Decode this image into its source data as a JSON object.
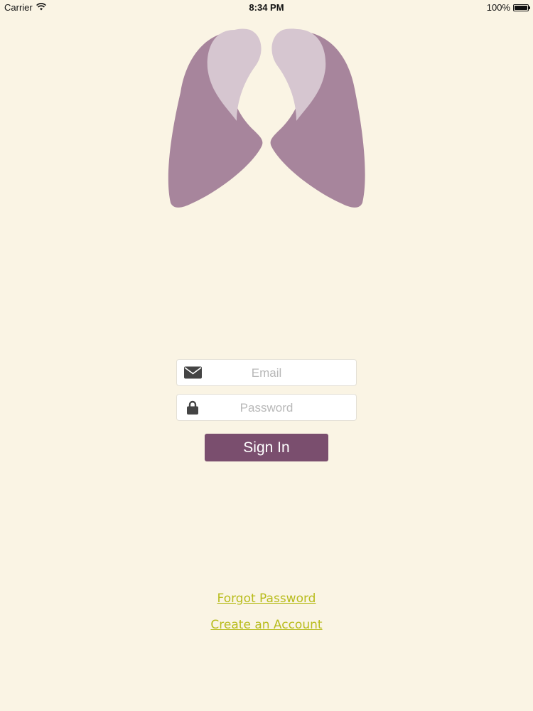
{
  "status_bar": {
    "carrier": "Carrier",
    "time": "8:34 PM",
    "battery_percent": "100%",
    "battery_level": 1.0,
    "wifi_icon": "wifi-icon",
    "battery_icon": "battery-icon"
  },
  "logo": {
    "icon": "lungs-logo-icon",
    "colors": {
      "dark": "#a7859c",
      "light": "#d6c6d0"
    }
  },
  "login": {
    "email_placeholder": "Email",
    "email_value": "",
    "email_icon": "envelope-icon",
    "password_placeholder": "Password",
    "password_value": "",
    "password_icon": "lock-icon",
    "sign_in_label": "Sign In"
  },
  "links": {
    "forgot_password": "Forgot Password",
    "create_account": "Create an Account"
  },
  "colors": {
    "background": "#faf4e4",
    "primary_button": "#7a4e6e",
    "link": "#b8bc1c"
  }
}
